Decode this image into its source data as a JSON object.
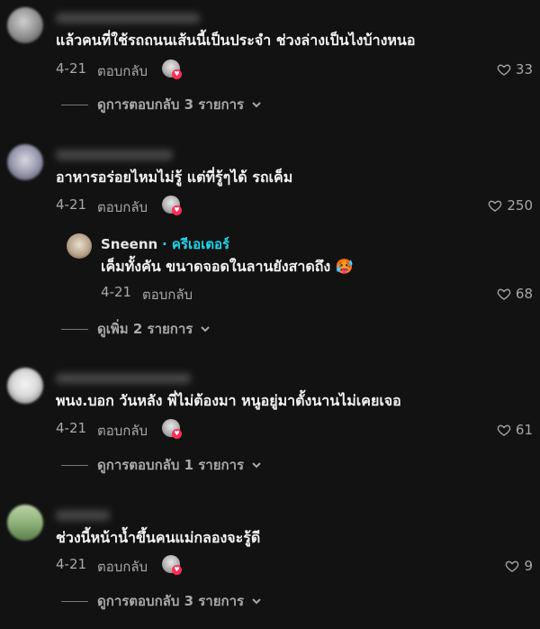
{
  "comments": [
    {
      "text": "แล้วคนที่ใช้รถถนนเส้นนี้เป็นประจำ ช่วงล่างเป็นไงบ้างหนอ",
      "date": "4-21",
      "reply_label": "ตอบกลับ",
      "likes": "33",
      "view_replies": "ดูการตอบกลับ 3 รายการ"
    },
    {
      "text": "อาหารอร่อยไหมไม่รู้ แต่ที่รู้ๆได้ รถเค็ม",
      "date": "4-21",
      "reply_label": "ตอบกลับ",
      "likes": "250",
      "reply": {
        "username": "Sneenn",
        "creator_tag": "· ครีเอเตอร์",
        "text": "เค็มทั้งคัน ขนาดจอดในลานยังสาดถึง 🥵",
        "date": "4-21",
        "reply_label": "ตอบกลับ",
        "likes": "68"
      },
      "view_replies": "ดูเพิ่ม 2 รายการ"
    },
    {
      "text": "พนง.บอก วันหลัง พี่ไม่ต้องมา หนูอยู่มาตั้งนานไม่เคยเจอ",
      "date": "4-21",
      "reply_label": "ตอบกลับ",
      "likes": "61",
      "view_replies": "ดูการตอบกลับ 1 รายการ"
    },
    {
      "text": "ช่วงนี้หน้าน้ำขึ้นคนแม่กลองจะรู้ดี",
      "date": "4-21",
      "reply_label": "ตอบกลับ",
      "likes": "9",
      "view_replies": "ดูการตอบกลับ 3 รายการ"
    }
  ],
  "icons": {
    "like": "heart-outline-icon",
    "expand": "chevron-down-icon",
    "creator_liked": "creator-liked-heart-icon"
  },
  "colors": {
    "background": "#121212",
    "text": "#f2f2f2",
    "muted": "#a8a8a8",
    "creator_tag": "#20d5ec",
    "liked_badge": "#fe2c55"
  }
}
